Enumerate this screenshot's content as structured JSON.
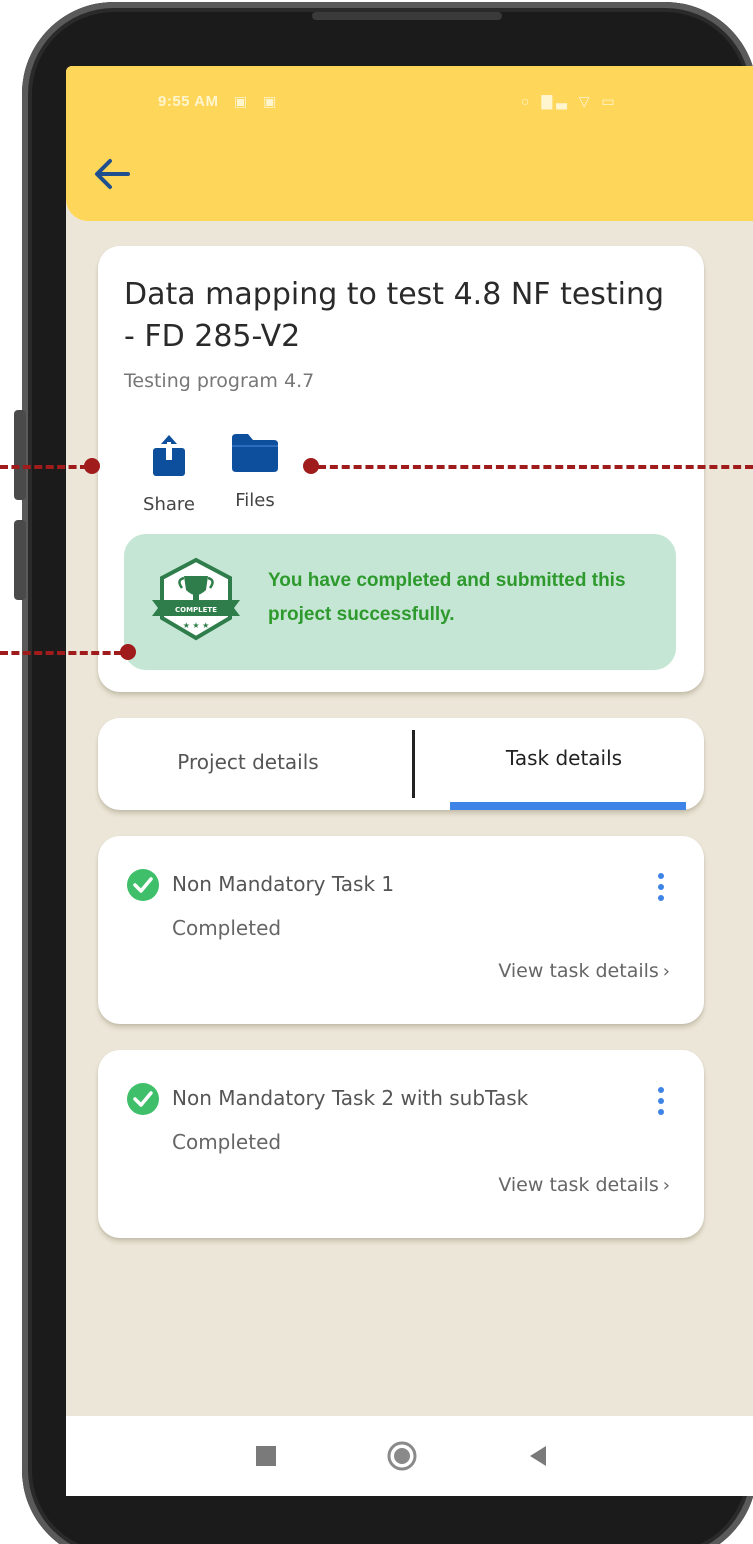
{
  "status_bar": {
    "time": "9:55 AM",
    "left_icons": "▣ ▣",
    "right_icons": "○ ▇▃ ▽ ▭"
  },
  "header": {
    "back_icon": "arrow-left-icon",
    "background_color": "#fdd65a"
  },
  "project": {
    "title": "Data mapping to test 4.8 NF testing - FD 285-V2",
    "subtitle": "Testing program 4.7",
    "actions": [
      {
        "label": "Share",
        "icon": "share-icon"
      },
      {
        "label": "Files",
        "icon": "folder-icon"
      }
    ],
    "banner": {
      "badge_text": "COMPLETE",
      "message": "You have completed and submitted this project successfully."
    }
  },
  "tabs": [
    {
      "label": "Project details",
      "active": false
    },
    {
      "label": "Task details",
      "active": true
    }
  ],
  "tasks": [
    {
      "name": "Non Mandatory Task 1",
      "status": "Completed",
      "link": "View task details",
      "chevron": "›"
    },
    {
      "name": "Non Mandatory Task 2 with subTask",
      "status": "Completed",
      "link": "View task details",
      "chevron": "›"
    }
  ],
  "nav": {
    "recent_icon": "square-icon",
    "home_icon": "circle-icon",
    "back_icon": "triangle-back-icon"
  },
  "colors": {
    "accent_blue": "#0d4f9c",
    "tab_indicator": "#3d84e6",
    "success_text": "#2e9a2e",
    "success_bg": "#c5e6d4",
    "callout": "#a01c1c"
  }
}
